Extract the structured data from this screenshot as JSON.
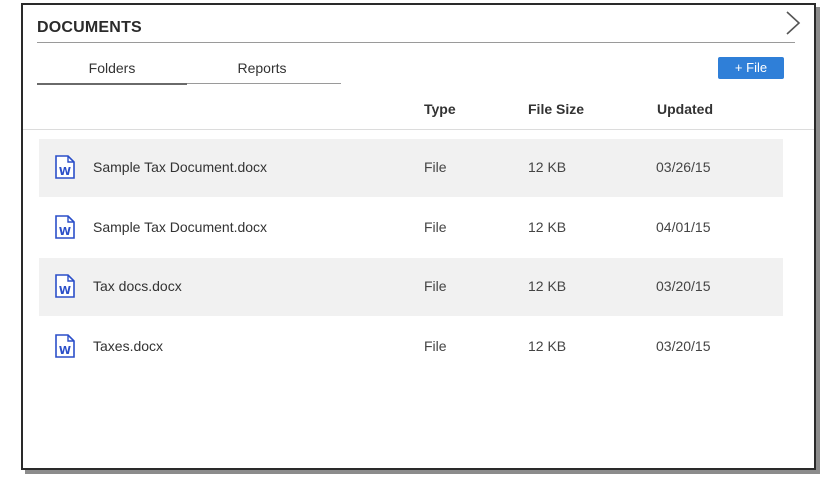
{
  "panel": {
    "title": "DOCUMENTS",
    "next_icon": "chevron-right-icon"
  },
  "tabs": [
    {
      "label": "Folders",
      "active": true
    },
    {
      "label": "Reports",
      "active": false
    }
  ],
  "actions": {
    "add_file_label": "+ File",
    "accent_color": "#2f7fd8"
  },
  "table": {
    "headers": [
      "Type",
      "File Size",
      "Updated"
    ],
    "rows": [
      {
        "icon": "word-document-icon",
        "name": "Sample Tax Document.docx",
        "type": "File",
        "size": "12 KB",
        "updated": "03/26/15"
      },
      {
        "icon": "word-document-icon",
        "name": "Sample Tax Document.docx",
        "type": "File",
        "size": "12 KB",
        "updated": "04/01/15"
      },
      {
        "icon": "word-document-icon",
        "name": "Tax docs.docx",
        "type": "File",
        "size": "12 KB",
        "updated": "03/20/15"
      },
      {
        "icon": "word-document-icon",
        "name": "Taxes.docx",
        "type": "File",
        "size": "12 KB",
        "updated": "03/20/15"
      }
    ]
  }
}
